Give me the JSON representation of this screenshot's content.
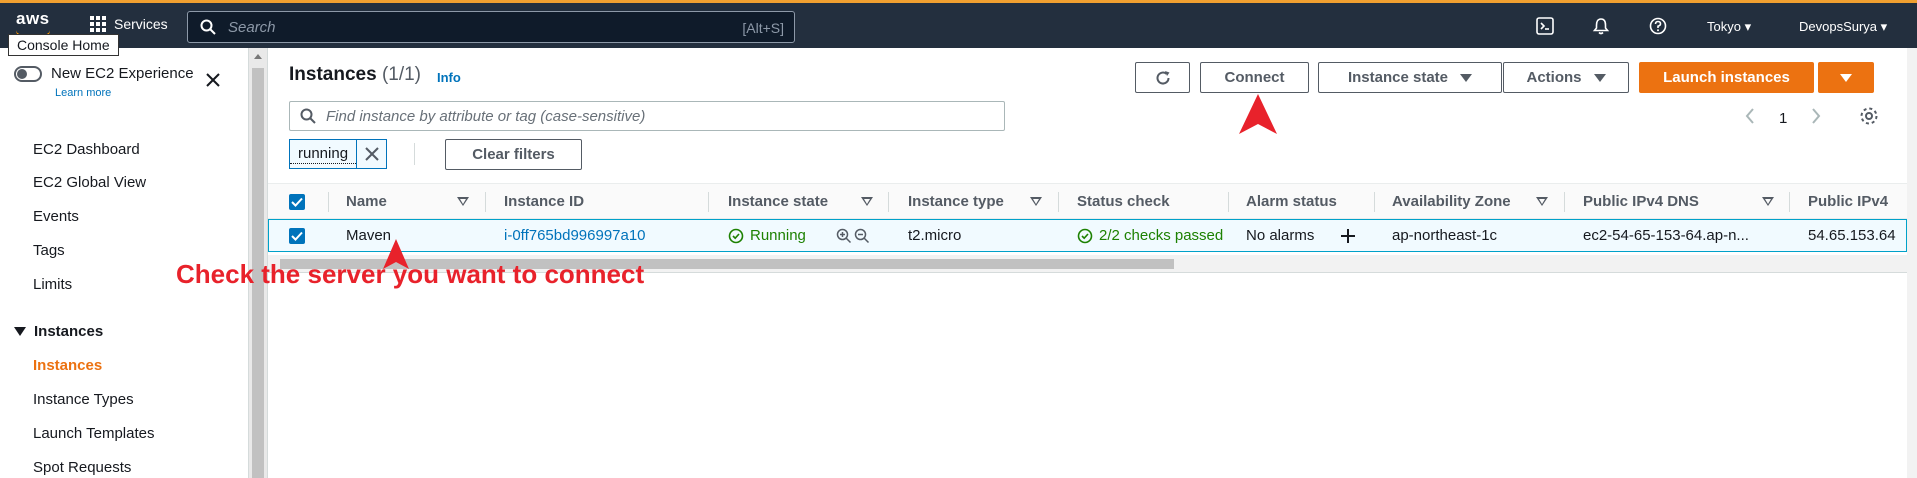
{
  "topnav": {
    "logo": "aws",
    "services": "Services",
    "search_placeholder": "Search",
    "search_shortcut": "[Alt+S]",
    "region": "Tokyo",
    "user": "DevopsSurya",
    "tooltip": "Console Home"
  },
  "sidebar": {
    "toggle_label": "New EC2 Experience",
    "learn_more": "Learn more",
    "items": [
      "EC2 Dashboard",
      "EC2 Global View",
      "Events",
      "Tags",
      "Limits"
    ],
    "section": "Instances",
    "section_items": [
      "Instances",
      "Instance Types",
      "Launch Templates",
      "Spot Requests"
    ]
  },
  "main": {
    "title": "Instances",
    "count": "(1/1)",
    "info": "Info",
    "buttons": {
      "connect": "Connect",
      "instance_state": "Instance state",
      "actions": "Actions",
      "launch": "Launch instances"
    },
    "filter_placeholder": "Find instance by attribute or tag (case-sensitive)",
    "page": "1",
    "token": "running",
    "clear_filters": "Clear filters"
  },
  "table": {
    "columns": [
      "Name",
      "Instance ID",
      "Instance state",
      "Instance type",
      "Status check",
      "Alarm status",
      "Availability Zone",
      "Public IPv4 DNS",
      "Public IPv4"
    ],
    "row": {
      "name": "Maven",
      "instance_id": "i-0ff765bd996997a10",
      "state": "Running",
      "type": "t2.micro",
      "status_check": "2/2 checks passed",
      "alarm": "No alarms",
      "az": "ap-northeast-1c",
      "dns": "ec2-54-65-153-64.ap-n...",
      "ipv4": "54.65.153.64"
    }
  },
  "annotation": "Check the server you want to connect",
  "colors": {
    "accent": "#ec7211",
    "link": "#0073bb",
    "success": "#1d8102",
    "annotation": "#e8222b",
    "nav": "#232f3e"
  }
}
